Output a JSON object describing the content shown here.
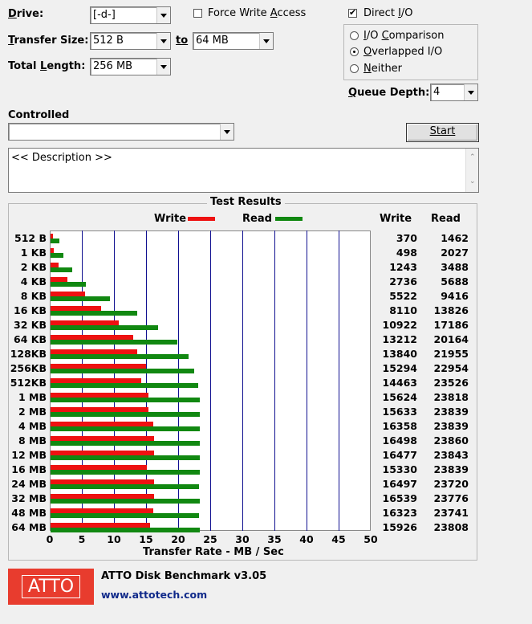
{
  "controls": {
    "drive_label": "Drive:",
    "drive_value": "[-d-]",
    "transfer_size_label": "Transfer Size:",
    "transfer_from": "512 B",
    "to_label": "to",
    "transfer_to": "64 MB",
    "total_length_label": "Total Length:",
    "total_length_value": "256 MB",
    "force_write_access_label": "Force Write Access",
    "force_write_access_checked": false,
    "direct_io_label": "Direct I/O",
    "direct_io_checked": true,
    "io_mode_options": [
      {
        "label": "I/O Comparison",
        "selected": false
      },
      {
        "label": "Overlapped I/O",
        "selected": true
      },
      {
        "label": "Neither",
        "selected": false
      }
    ],
    "queue_depth_label": "Queue Depth:",
    "queue_depth_value": "4",
    "controlled_label": "Controlled",
    "controlled_value": "",
    "start_button": "Start",
    "description_text": "<< Description >>"
  },
  "results": {
    "title": "Test Results",
    "legend_write": "Write",
    "legend_read": "Read",
    "col_write": "Write",
    "col_read": "Read",
    "write_color": "#ee1111",
    "read_color": "#118811"
  },
  "chart_data": {
    "type": "bar",
    "orientation": "horizontal",
    "xlabel": "Transfer Rate - MB / Sec",
    "xlim": [
      0,
      50
    ],
    "xticks": [
      "0",
      "5",
      "10",
      "15",
      "20",
      "25",
      "30",
      "35",
      "40",
      "45",
      "50"
    ],
    "categories": [
      "512 B",
      "1 KB",
      "2 KB",
      "4 KB",
      "8 KB",
      "16 KB",
      "32 KB",
      "64 KB",
      "128KB",
      "256KB",
      "512KB",
      "1 MB",
      "2 MB",
      "4 MB",
      "8 MB",
      "12 MB",
      "16 MB",
      "24 MB",
      "32 MB",
      "48 MB",
      "64 MB"
    ],
    "series": [
      {
        "name": "Write",
        "values_kb": [
          370,
          498,
          1243,
          2736,
          5522,
          8110,
          10922,
          13212,
          13840,
          15294,
          14463,
          15624,
          15633,
          16358,
          16498,
          16477,
          15330,
          16497,
          16539,
          16323,
          15926
        ]
      },
      {
        "name": "Read",
        "values_kb": [
          1462,
          2027,
          3488,
          5688,
          9416,
          13826,
          17186,
          20164,
          21955,
          22954,
          23526,
          23818,
          23839,
          23839,
          23860,
          23843,
          23839,
          23720,
          23776,
          23741,
          23808
        ]
      }
    ]
  },
  "footer": {
    "logo_text": "ATTO",
    "app_title": "ATTO Disk Benchmark v3.05",
    "website": "www.attotech.com"
  }
}
